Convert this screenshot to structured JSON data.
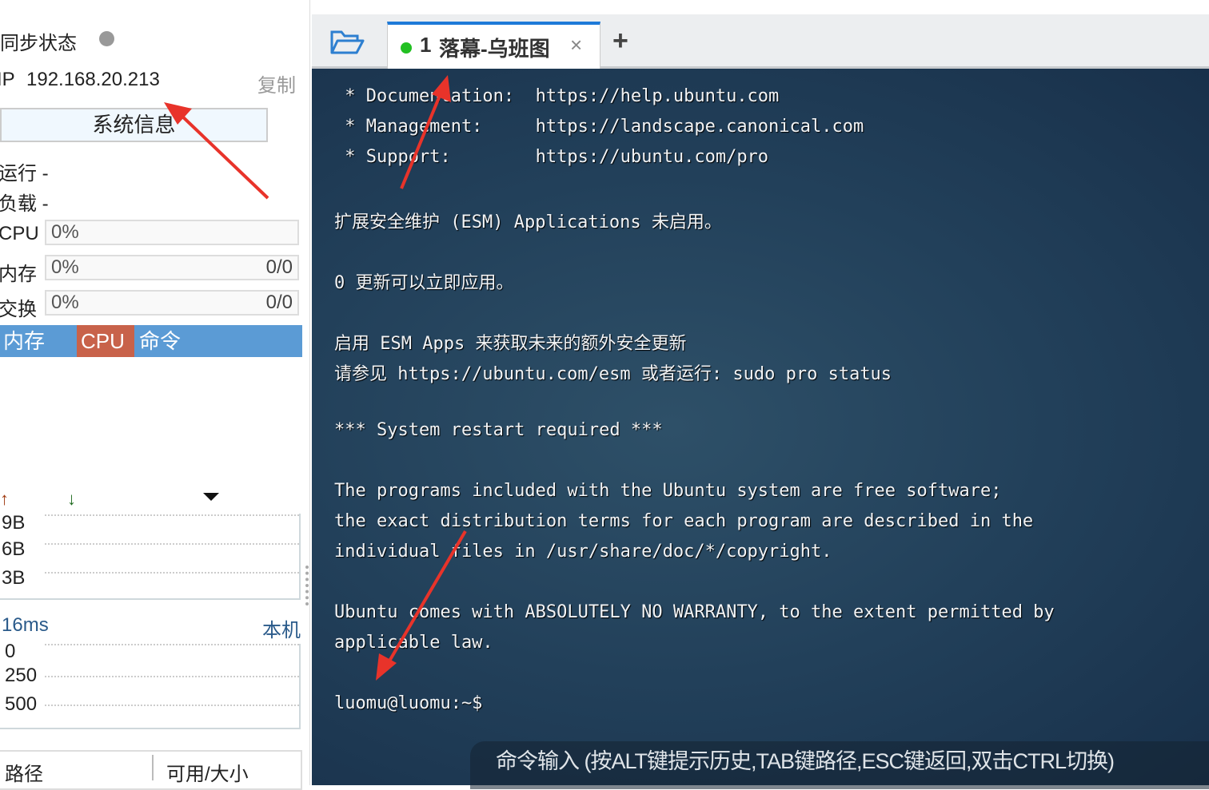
{
  "sidebar": {
    "sync_label": "同步状态",
    "ip_label": "IP",
    "ip": "192.168.20.213",
    "copy": "复制",
    "sysinfo_button": "系统信息",
    "uptime": "运行 -",
    "load": "负载 -",
    "cpu": {
      "label": "CPU",
      "percent": "0%"
    },
    "memory": {
      "label": "内存",
      "percent": "0%",
      "value": "0/0"
    },
    "swap": {
      "label": "交换",
      "percent": "0%",
      "value": "0/0"
    },
    "tabs": [
      {
        "label": "内存"
      },
      {
        "label": "CPU",
        "active": true
      },
      {
        "label": "命令"
      }
    ],
    "net": {
      "ticks": [
        "9B",
        "6B",
        "3B"
      ]
    },
    "ping": {
      "latency": "16ms",
      "host": "本机",
      "ticks": [
        "0",
        "250",
        "500"
      ]
    },
    "disk_headers": [
      "路径",
      "可用/大小"
    ]
  },
  "tabbar": {
    "tab": {
      "number": "1",
      "title": "落幕-乌班图",
      "status_color": "#22c022"
    },
    "add": "+"
  },
  "terminal": {
    "lines": [
      " * Documentation:  https://help.ubuntu.com",
      " * Management:     https://landscape.canonical.com",
      " * Support:        https://ubuntu.com/pro",
      "",
      "扩展安全维护 (ESM) Applications 未启用。",
      "",
      "0 更新可以立即应用。",
      "",
      "启用 ESM Apps 来获取未来的额外安全更新",
      "请参见 https://ubuntu.com/esm 或者运行: sudo pro status",
      "",
      "*** System restart required ***",
      "",
      "The programs included with the Ubuntu system are free software;",
      "the exact distribution terms for each program are described in the",
      "individual files in /usr/share/doc/*/copyright.",
      "",
      "Ubuntu comes with ABSOLUTELY NO WARRANTY, to the extent permitted by",
      "applicable law.",
      "",
      "luomu@luomu:~$"
    ],
    "command_placeholder": "命令输入 (按ALT键提示历史,TAB键路径,ESC键返回,双击CTRL切换)"
  },
  "colors": {
    "accent": "#5b9bd5",
    "active_tab": "#c8624a",
    "annotation": "#e8332a"
  }
}
